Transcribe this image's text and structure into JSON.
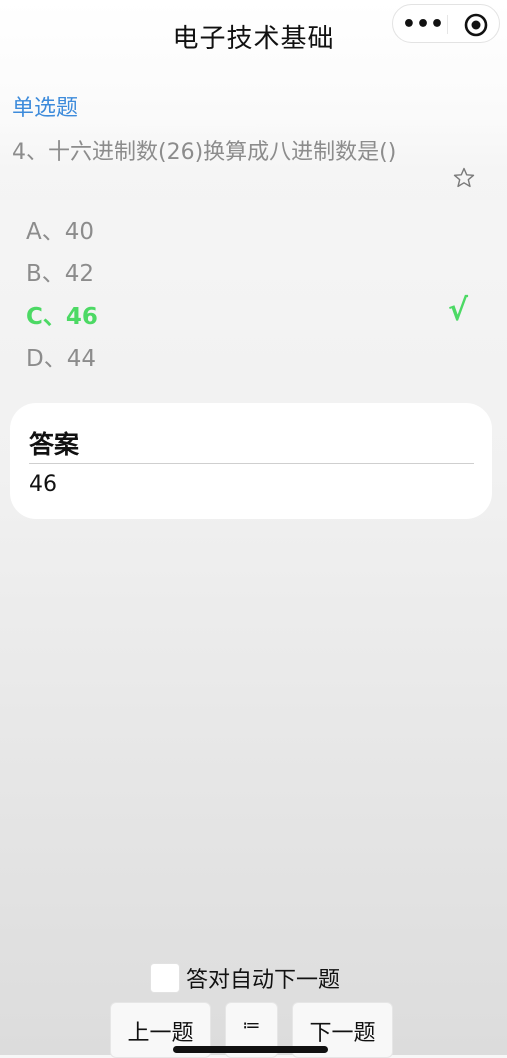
{
  "header": {
    "title": "电子技术基础",
    "more_icon": "more-dots-icon",
    "close_icon": "target-circle-icon"
  },
  "question": {
    "type": "单选题",
    "text": "4、十六进制数(26)换算成八进制数是()",
    "favorite_icon": "star-outline-icon",
    "options": [
      {
        "label": "A、40",
        "correct": false
      },
      {
        "label": "B、42",
        "correct": false
      },
      {
        "label": "C、46",
        "correct": true
      },
      {
        "label": "D、44",
        "correct": false
      }
    ],
    "correct_mark": "√"
  },
  "answer": {
    "heading": "答案",
    "value": "46"
  },
  "footer": {
    "auto_next_label": "答对自动下一题",
    "auto_next_checked": false,
    "prev_label": "上一题",
    "list_icon": "≔",
    "next_label": "下一题"
  },
  "colors": {
    "link_blue": "#3d8bdb",
    "correct_green": "#4cd964",
    "muted_gray": "#8c8c8c"
  }
}
